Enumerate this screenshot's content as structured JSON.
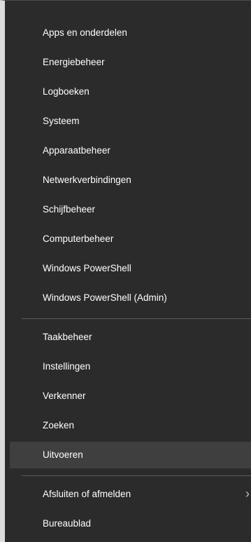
{
  "menu": {
    "items": [
      {
        "label": "Apps en onderdelen"
      },
      {
        "label": "Energiebeheer"
      },
      {
        "label": "Logboeken"
      },
      {
        "label": "Systeem"
      },
      {
        "label": "Apparaatbeheer"
      },
      {
        "label": "Netwerkverbindingen"
      },
      {
        "label": "Schijfbeheer"
      },
      {
        "label": "Computerbeheer"
      },
      {
        "label": "Windows PowerShell"
      },
      {
        "label": "Windows PowerShell (Admin)"
      },
      {
        "label": "Taakbeheer"
      },
      {
        "label": "Instellingen"
      },
      {
        "label": "Verkenner"
      },
      {
        "label": "Zoeken"
      },
      {
        "label": "Uitvoeren",
        "highlighted": true
      },
      {
        "label": "Afsluiten of afmelden",
        "has_submenu": true,
        "submenu_icon": "chevron-right-icon"
      },
      {
        "label": "Bureaublad"
      }
    ]
  },
  "colors": {
    "menu_background": "#2b2b2b",
    "hover_background": "#3f3f3f",
    "text": "#ffffff",
    "separator": "#5c5c5c"
  }
}
